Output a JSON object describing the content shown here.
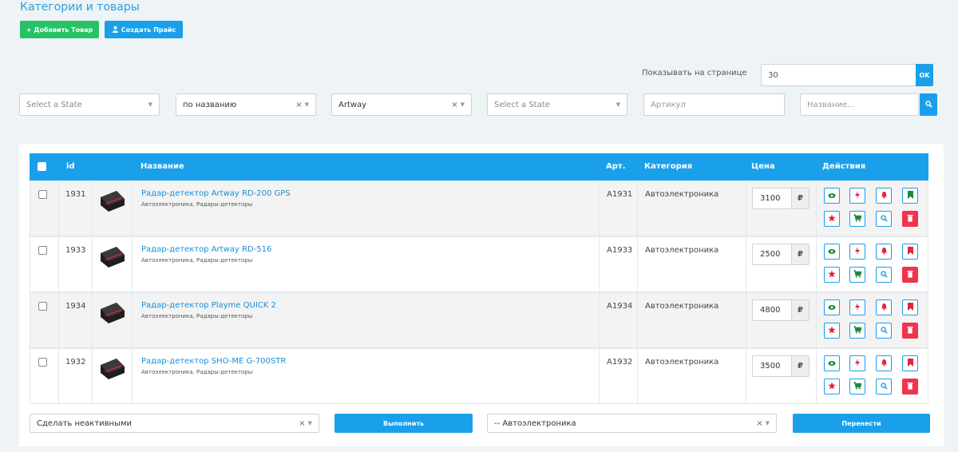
{
  "page_title": "Категории и товары",
  "toolbar": {
    "add_label": "Добавить Товар",
    "price_label": "Создать Прайс"
  },
  "per_page": {
    "label": "Показывать на странице",
    "value": "30",
    "ok": "OK"
  },
  "filters": {
    "state1": "Select a State",
    "sort": "по названию",
    "brand": "Artway",
    "state2": "Select a State",
    "article_placeholder": "Артикул",
    "name_placeholder": "Название..."
  },
  "table": {
    "headers": {
      "id": "id",
      "name": "Название",
      "art": "Арт.",
      "category": "Категория",
      "price": "Цена",
      "actions": "Действия"
    },
    "rows": [
      {
        "id": "1931",
        "name": "Радар-детектор Artway RD-200 GPS",
        "sub": "Автоэлектроника, Радары-детекторы",
        "art": "A1931",
        "category": "Автоэлектроника",
        "price": "3100",
        "currency": "₽",
        "bookmark_color": "#1d8a3a"
      },
      {
        "id": "1933",
        "name": "Радар-детектор Artway RD-516",
        "sub": "Автоэлектроника, Радары-детекторы",
        "art": "A1933",
        "category": "Автоэлектроника",
        "price": "2500",
        "currency": "₽",
        "bookmark_color": "#e5233d"
      },
      {
        "id": "1934",
        "name": "Радар-детектор Playme QUICK 2",
        "sub": "Автоэлектроника, Радары-детекторы",
        "art": "A1934",
        "category": "Автоэлектроника",
        "price": "4800",
        "currency": "₽",
        "bookmark_color": "#e5233d"
      },
      {
        "id": "1932",
        "name": "Радар-детектор SHO-ME G-700STR",
        "sub": "Автоэлектроника, Радары-детекторы",
        "art": "A1932",
        "category": "Автоэлектроника",
        "price": "3500",
        "currency": "₽",
        "bookmark_color": "#e5233d"
      }
    ]
  },
  "bulk": {
    "action": "Сделать неактивными",
    "execute": "Выполнить",
    "category": "-- Автоэлектроника",
    "move": "Перенести"
  },
  "colors": {
    "accent": "#1aa0ea",
    "green": "#27c265",
    "danger": "#f0344d"
  }
}
